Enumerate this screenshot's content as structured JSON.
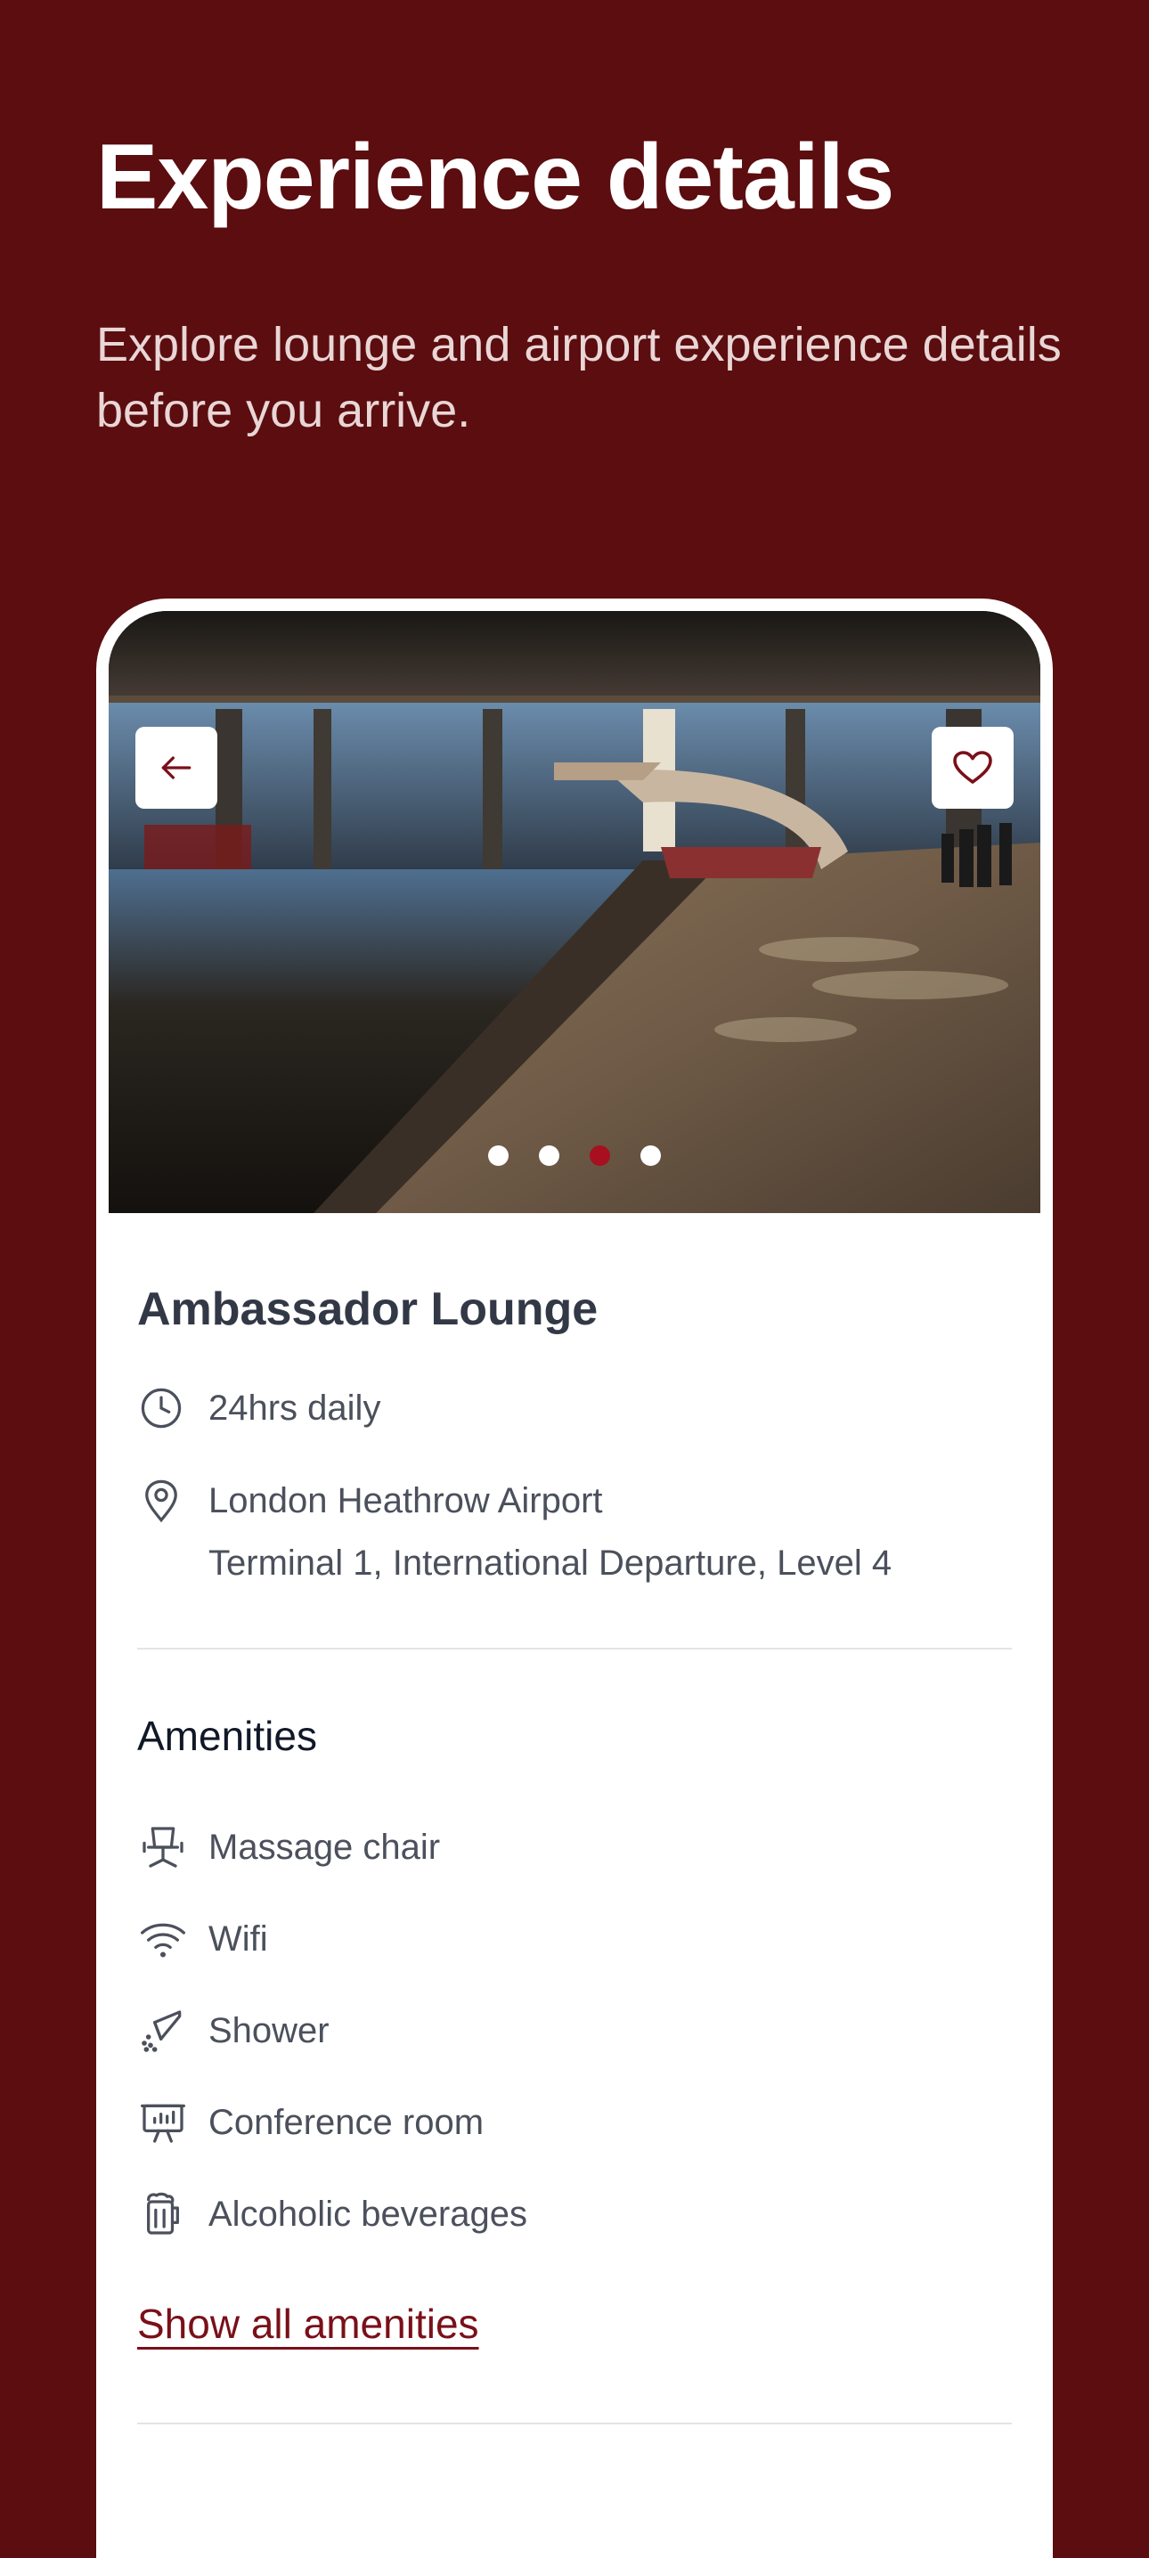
{
  "header": {
    "title": "Experience details",
    "subtitle": "Explore lounge and airport experience details before you arrive."
  },
  "gallery": {
    "image_description_icon": "lounge-photo",
    "slide_count": 4,
    "active_slide": 3,
    "back_icon": "arrow-left-icon",
    "favorite_icon": "heart-icon"
  },
  "lounge": {
    "name": "Ambassador Lounge",
    "hours": "24hrs daily",
    "location_line1": "London Heathrow Airport",
    "location_line2": "Terminal 1, International Departure, Level 4"
  },
  "amenities": {
    "title": "Amenities",
    "items": [
      {
        "label": "Massage chair",
        "icon": "massage-chair-icon"
      },
      {
        "label": "Wifi",
        "icon": "wifi-icon"
      },
      {
        "label": "Shower",
        "icon": "shower-icon"
      },
      {
        "label": "Conference room",
        "icon": "conference-room-icon"
      },
      {
        "label": "Alcoholic beverages",
        "icon": "beer-icon"
      }
    ],
    "show_all_label": "Show all amenities"
  },
  "colors": {
    "background": "#5b0d0f",
    "accent": "#7a1019",
    "active_dot": "#a8101f"
  }
}
